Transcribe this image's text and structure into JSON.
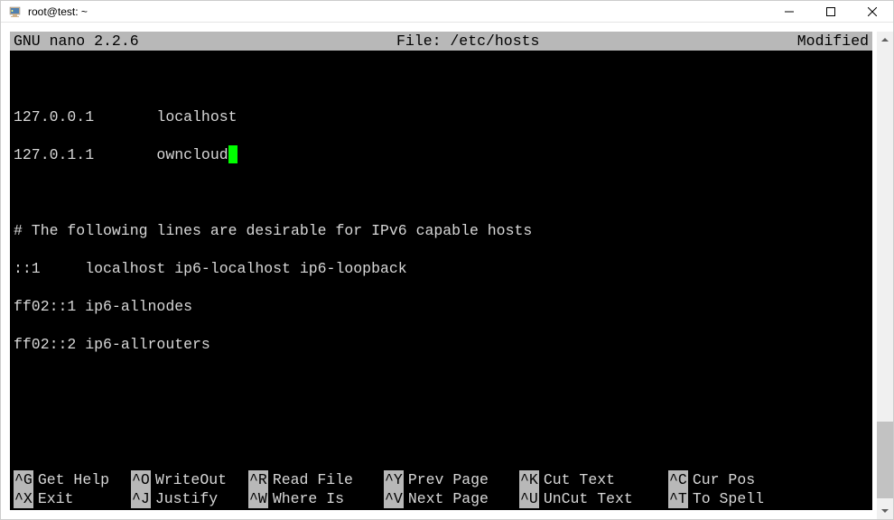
{
  "window": {
    "title": "root@test: ~"
  },
  "nano": {
    "app": "GNU nano 2.2.6",
    "file_label": "File: /etc/hosts",
    "status": "Modified"
  },
  "content": {
    "line1": "127.0.0.1       localhost",
    "line2_a": "127.0.1.1       owncloud",
    "line4": "# The following lines are desirable for IPv6 capable hosts",
    "line5": "::1     localhost ip6-localhost ip6-loopback",
    "line6": "ff02::1 ip6-allnodes",
    "line7": "ff02::2 ip6-allrouters"
  },
  "shortcuts": {
    "row1": [
      {
        "key": "^G",
        "label": "Get Help"
      },
      {
        "key": "^O",
        "label": "WriteOut"
      },
      {
        "key": "^R",
        "label": "Read File"
      },
      {
        "key": "^Y",
        "label": "Prev Page"
      },
      {
        "key": "^K",
        "label": "Cut Text"
      },
      {
        "key": "^C",
        "label": "Cur Pos"
      }
    ],
    "row2": [
      {
        "key": "^X",
        "label": "Exit"
      },
      {
        "key": "^J",
        "label": "Justify"
      },
      {
        "key": "^W",
        "label": "Where Is"
      },
      {
        "key": "^V",
        "label": "Next Page"
      },
      {
        "key": "^U",
        "label": "UnCut Text"
      },
      {
        "key": "^T",
        "label": "To Spell"
      }
    ]
  }
}
